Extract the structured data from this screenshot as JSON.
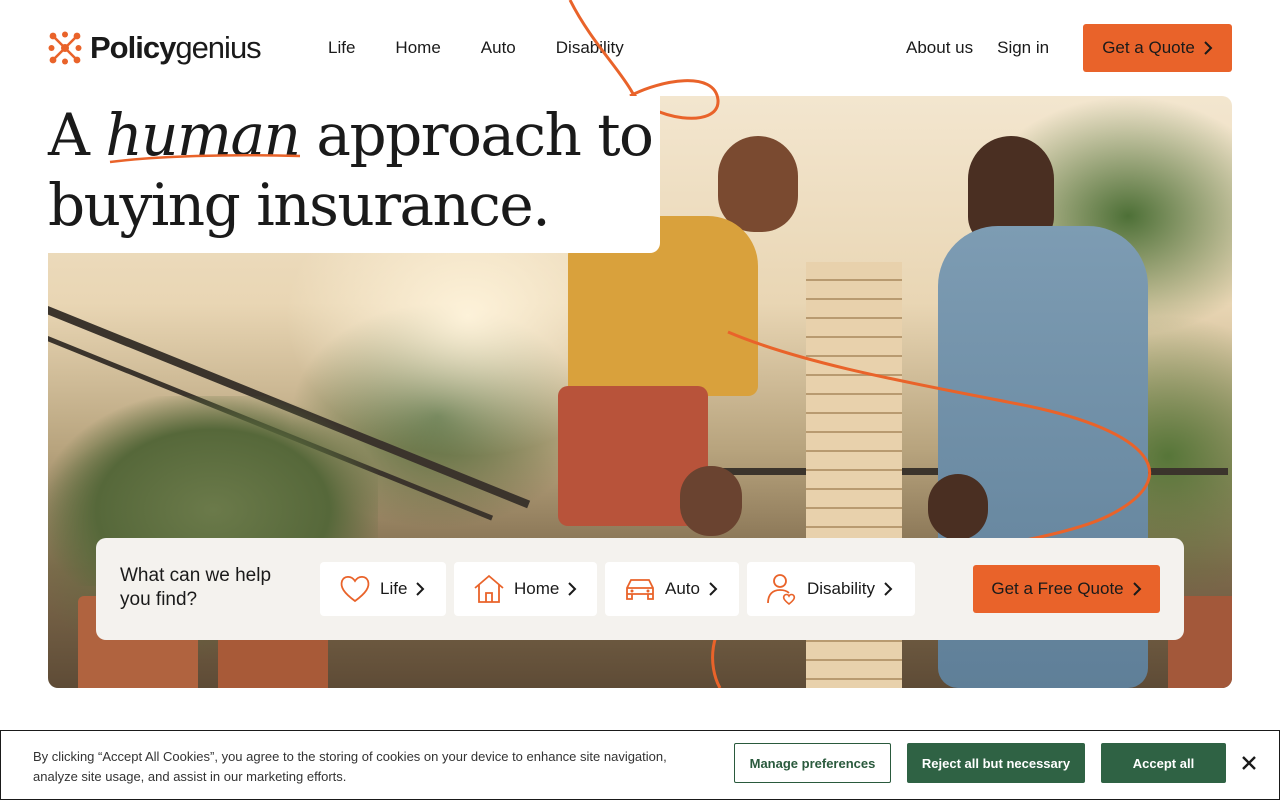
{
  "brand": {
    "name_bold": "Policy",
    "name_light": "genius",
    "accent": "#e9632a",
    "green": "#2f6244"
  },
  "nav": {
    "main": [
      "Life",
      "Home",
      "Auto",
      "Disability"
    ],
    "about": "About us",
    "sign_in": "Sign in",
    "cta": "Get a Quote"
  },
  "hero": {
    "title_pre": "A ",
    "title_em": "human",
    "title_post": " approach to",
    "title_line2": "buying insurance."
  },
  "finder": {
    "question": "What can we help you find?",
    "chips": [
      {
        "label": "Life",
        "icon": "heart-icon"
      },
      {
        "label": "Home",
        "icon": "house-icon"
      },
      {
        "label": "Auto",
        "icon": "car-icon"
      },
      {
        "label": "Disability",
        "icon": "person-heart-icon"
      }
    ],
    "cta": "Get a Free Quote"
  },
  "cookie": {
    "text": "By clicking “Accept All Cookies”, you agree to the storing of cookies on your device to enhance site navigation, analyze site usage, and assist in our marketing efforts.",
    "manage": "Manage preferences",
    "reject": "Reject all but necessary",
    "accept": "Accept all"
  }
}
